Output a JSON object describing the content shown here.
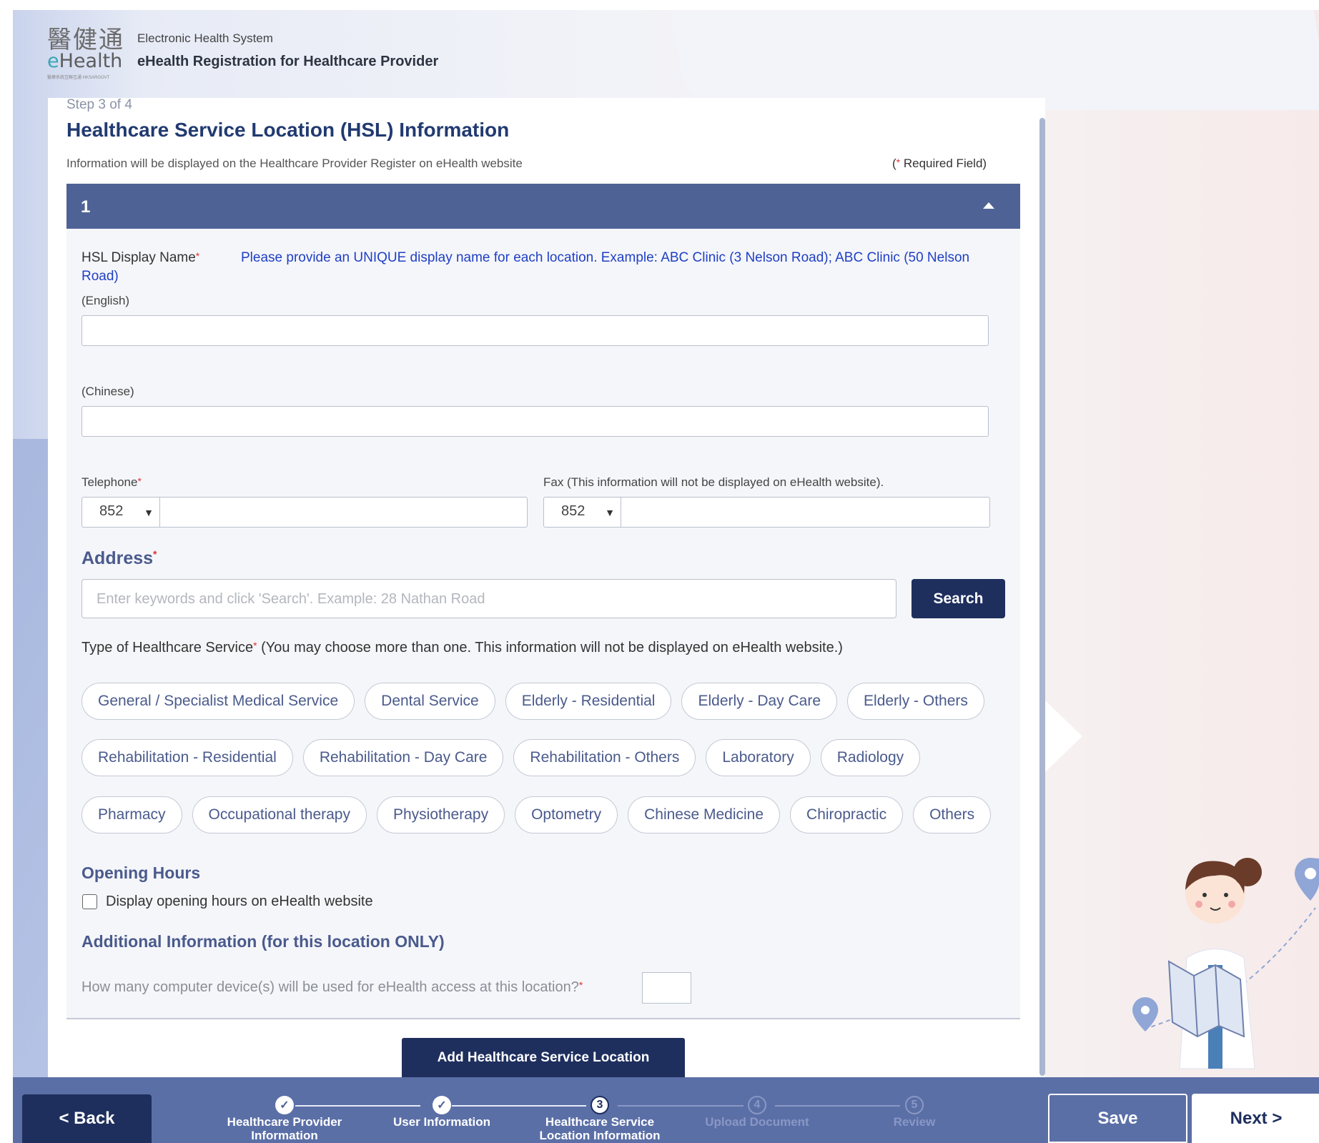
{
  "header": {
    "logo_cn": "醫健通",
    "logo_en_prefix": "e",
    "logo_en_rest": "Health",
    "logo_tagline": "醫療系統互聯互通 HKSARGOVT",
    "system_name": "Electronic Health System",
    "registration_title": "eHealth Registration for Healthcare Provider"
  },
  "page": {
    "step": "Step 3 of 4",
    "title": "Healthcare Service Location (HSL) Information",
    "info_line": "Information will be displayed on the Healthcare Provider Register on eHealth website",
    "required_open": "(",
    "required_star": "*",
    "required_text": " Required Field)"
  },
  "panel": {
    "number": "1",
    "display_name_label": "HSL Display Name",
    "display_name_hint": "Please provide an UNIQUE display name for each location. Example: ABC Clinic (3 Nelson Road); ABC Clinic (50 Nelson Road)",
    "english_label": "(English)",
    "english_value": "",
    "chinese_label": "(Chinese)",
    "chinese_value": "",
    "telephone_label": "Telephone",
    "telephone_code": "852",
    "telephone_value": "",
    "fax_label": "Fax (This information will not be displayed on eHealth website).",
    "fax_code": "852",
    "fax_value": "",
    "address_label": "Address",
    "address_placeholder": "Enter keywords and click 'Search'.  Example: 28 Nathan Road",
    "search_button": "Search",
    "service_type_label": "Type of Healthcare Service",
    "service_type_note": " (You may choose more than one. This information will not be displayed on eHealth website.)",
    "service_chips_row1": [
      "General / Specialist Medical Service",
      "Dental Service",
      "Elderly - Residential",
      "Elderly - Day Care",
      "Elderly - Others"
    ],
    "service_chips_row2": [
      "Rehabilitation - Residential",
      "Rehabilitation - Day Care",
      "Rehabilitation - Others",
      "Laboratory",
      "Radiology"
    ],
    "service_chips_row3": [
      "Pharmacy",
      "Occupational therapy",
      "Physiotherapy",
      "Optometry",
      "Chinese Medicine",
      "Chiropractic",
      "Others"
    ],
    "opening_hours_title": "Opening Hours",
    "opening_hours_checkbox": "Display opening hours on eHealth website",
    "opening_hours_checked": false,
    "additional_title": "Additional Information (for this location ONLY)",
    "devices_question": "How many computer device(s) will be used for eHealth access at this location?",
    "devices_value": ""
  },
  "add_location_button": "Add Healthcare Service Location",
  "footer": {
    "back_button": "< Back",
    "save_button": "Save",
    "next_button": "Next >",
    "steps": [
      {
        "num": "✓",
        "label": "Healthcare Provider Information",
        "state": "done"
      },
      {
        "num": "✓",
        "label": "User Information",
        "state": "done"
      },
      {
        "num": "3",
        "label": "Healthcare Service Location Information",
        "state": "current"
      },
      {
        "num": "4",
        "label": "Upload Document",
        "state": "future"
      },
      {
        "num": "5",
        "label": "Review",
        "state": "future"
      }
    ]
  },
  "colors": {
    "primary_dark": "#1e2f5e",
    "panel_header": "#4f6296",
    "footer_bar": "#5b6fa7",
    "hint_blue": "#1f3fc4",
    "required_red": "#d33"
  }
}
